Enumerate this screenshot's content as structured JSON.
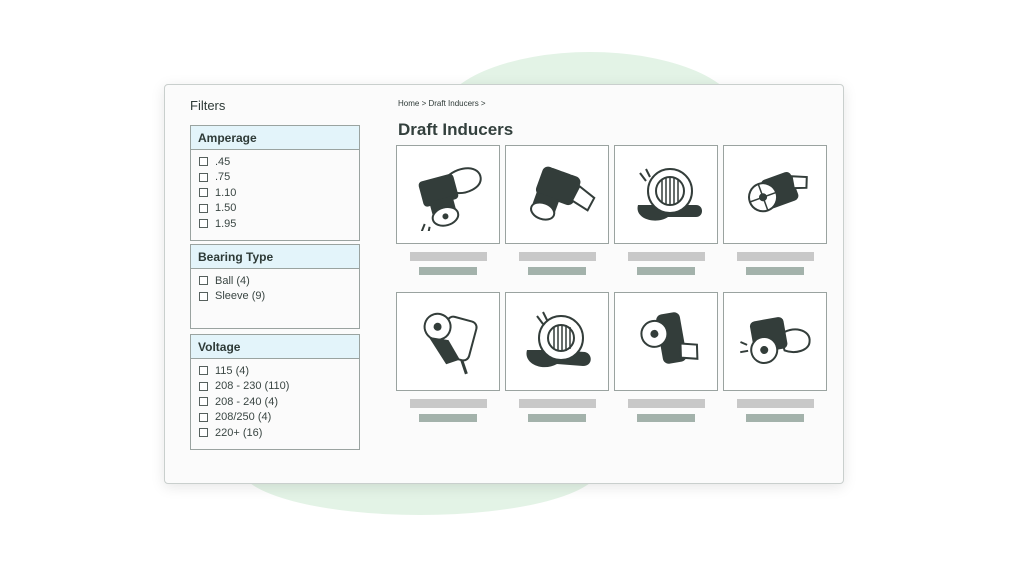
{
  "filters": {
    "title": "Filters",
    "groups": [
      {
        "title": "Amperage",
        "options": [
          ".45",
          ".75",
          "1.10",
          "1.50",
          "1.95"
        ]
      },
      {
        "title": "Bearing Type",
        "options": [
          "Ball (4)",
          "Sleeve (9)"
        ]
      },
      {
        "title": "Voltage",
        "options": [
          "115 (4)",
          "208 - 230 (110)",
          "208 - 240 (4)",
          "208/250 (4)",
          "220+ (16)"
        ]
      }
    ]
  },
  "breadcrumb": "Home > Draft Inducers >",
  "page_title": "Draft Inducers",
  "products": [
    {
      "icon": "draft-inducer-icon"
    },
    {
      "icon": "draft-inducer-icon"
    },
    {
      "icon": "draft-inducer-icon"
    },
    {
      "icon": "draft-inducer-icon"
    },
    {
      "icon": "draft-inducer-icon"
    },
    {
      "icon": "draft-inducer-icon"
    },
    {
      "icon": "draft-inducer-icon"
    },
    {
      "icon": "draft-inducer-icon"
    }
  ],
  "colors": {
    "accent_header": "#e3f4fa",
    "icon_fill": "#333d3a",
    "background_blob": "#e3f3e6",
    "placeholder_name": "#c8c8c8",
    "placeholder_price": "#a3b2ab"
  }
}
